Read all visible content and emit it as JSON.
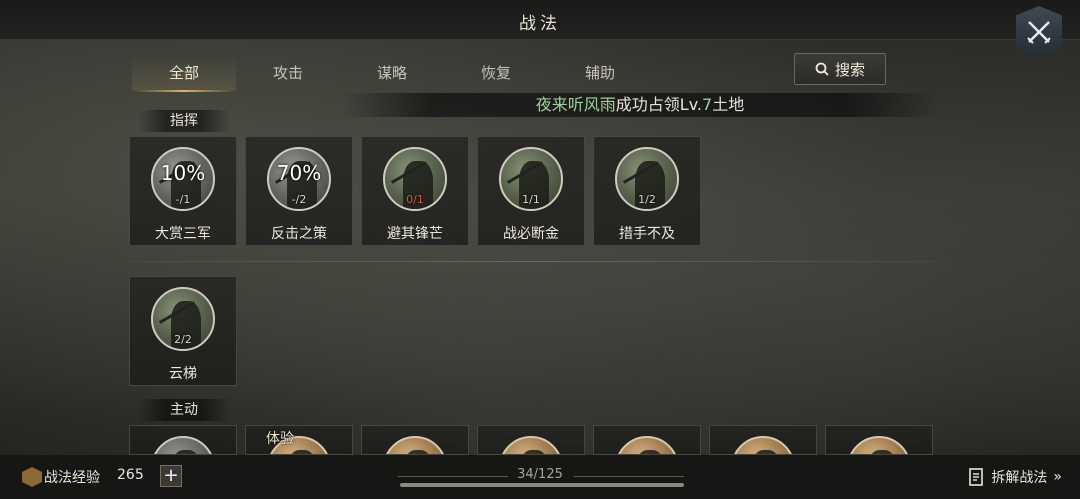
{
  "header": {
    "title": "战法"
  },
  "tabs": [
    {
      "label": "全部",
      "active": true
    },
    {
      "label": "攻击",
      "active": false
    },
    {
      "label": "谋略",
      "active": false
    },
    {
      "label": "恢复",
      "active": false
    },
    {
      "label": "辅助",
      "active": false
    }
  ],
  "search": {
    "label": "搜索"
  },
  "notice": {
    "name": "夜来听风雨",
    "text_a": "成功占领Lv.",
    "level": "7",
    "text_b": "土地"
  },
  "sections": {
    "command": "指挥",
    "active": "主动"
  },
  "command_skills": [
    {
      "name": "大赏三军",
      "percent": "10%",
      "count": "-/1",
      "icon": "soldier-portrait-icon"
    },
    {
      "name": "反击之策",
      "percent": "70%",
      "count": "-/2",
      "icon": "soldier-portrait-icon"
    },
    {
      "name": "避其锋芒",
      "percent": "",
      "count": "0/1",
      "icon": "soldier-portrait-icon"
    },
    {
      "name": "战必断金",
      "percent": "",
      "count": "1/1",
      "icon": "soldier-portrait-icon"
    },
    {
      "name": "措手不及",
      "percent": "",
      "count": "1/2",
      "icon": "soldier-portrait-icon"
    },
    {
      "name": "云梯",
      "percent": "",
      "count": "2/2",
      "icon": "soldier-portrait-icon"
    }
  ],
  "active_skills": {
    "trial_badge": "体验"
  },
  "footer": {
    "exp_label": "战法经验",
    "exp_value": "265",
    "plus": "+",
    "page": "34/125",
    "dismantle": "拆解战法",
    "dismantle_arrow": "»"
  },
  "colors": {
    "highlight_name": "#9cd39c",
    "tab_underline": "#d9b465",
    "count_red": "#d65a4b"
  }
}
